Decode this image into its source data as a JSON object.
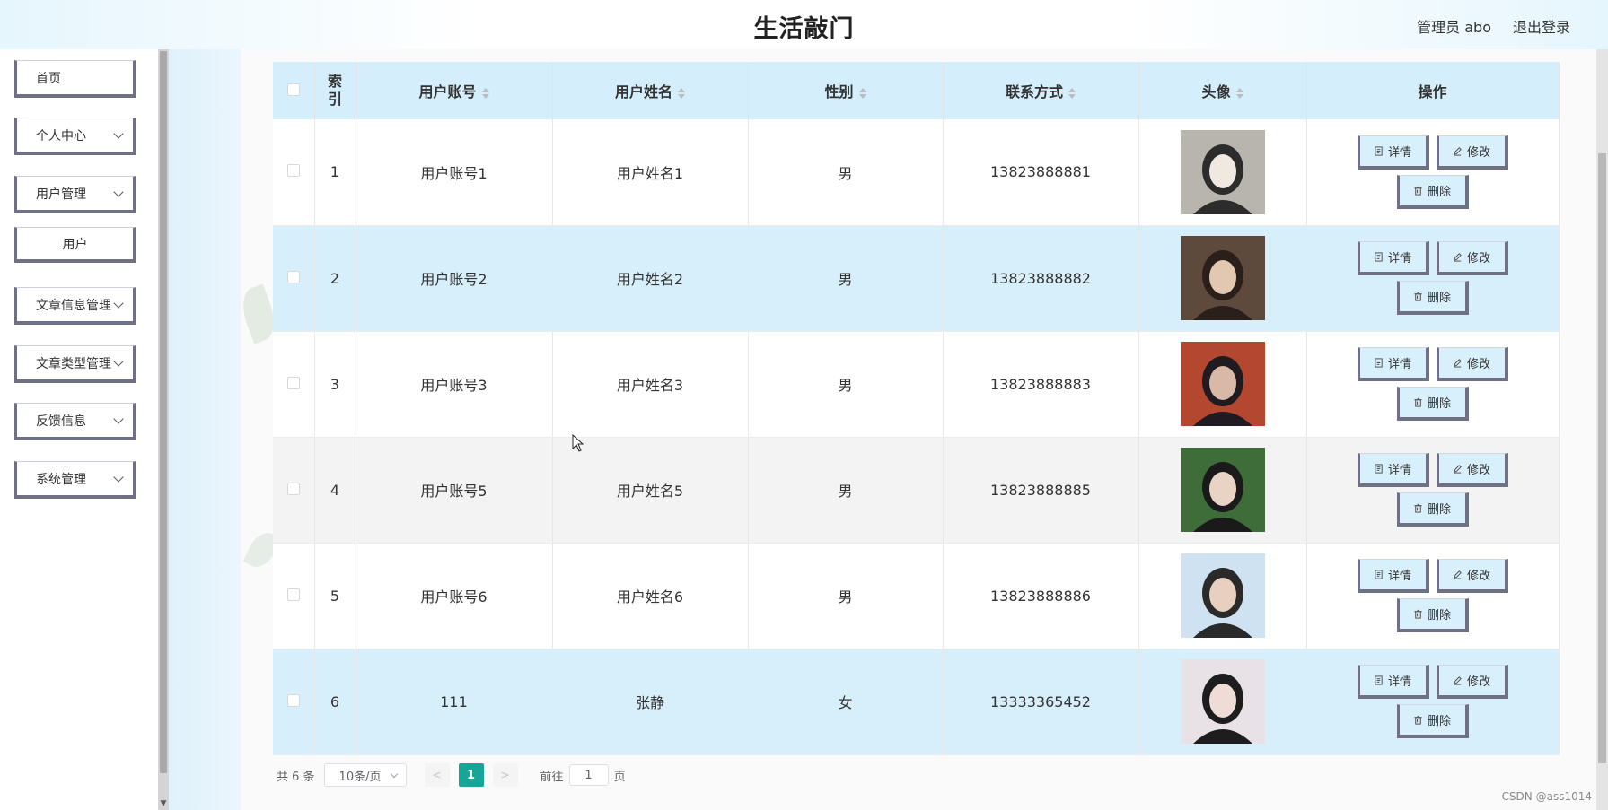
{
  "header": {
    "title": "生活敲门",
    "user_label": "管理员 abo",
    "logout_label": "退出登录"
  },
  "sidebar": {
    "items": [
      {
        "label": "首页"
      },
      {
        "label": "个人中心"
      },
      {
        "label": "用户管理"
      },
      {
        "label": "用户"
      },
      {
        "label": "文章信息管理"
      },
      {
        "label": "文章类型管理"
      },
      {
        "label": "反馈信息"
      },
      {
        "label": "系统管理"
      }
    ]
  },
  "table": {
    "columns": [
      "索引",
      "用户账号",
      "用户姓名",
      "性别",
      "联系方式",
      "头像",
      "操作"
    ],
    "rows": [
      {
        "index": "1",
        "account": "用户账号1",
        "name": "用户姓名1",
        "gender": "男",
        "phone": "13823888881"
      },
      {
        "index": "2",
        "account": "用户账号2",
        "name": "用户姓名2",
        "gender": "男",
        "phone": "13823888882"
      },
      {
        "index": "3",
        "account": "用户账号3",
        "name": "用户姓名3",
        "gender": "男",
        "phone": "13823888883"
      },
      {
        "index": "4",
        "account": "用户账号5",
        "name": "用户姓名5",
        "gender": "男",
        "phone": "13823888885"
      },
      {
        "index": "5",
        "account": "用户账号6",
        "name": "用户姓名6",
        "gender": "男",
        "phone": "13823888886"
      },
      {
        "index": "6",
        "account": "111",
        "name": "张静",
        "gender": "女",
        "phone": "13333365452"
      }
    ],
    "actions": {
      "detail": "详情",
      "edit": "修改",
      "delete": "删除"
    }
  },
  "pagination": {
    "total_text": "共 6 条",
    "page_size": "10条/页",
    "current_page": "1",
    "goto_prefix": "前往",
    "goto_value": "1",
    "goto_suffix": "页"
  },
  "watermark": "CSDN @ass1014",
  "colors": {
    "accent": "#16a596",
    "header_row": "#d4eefb",
    "button_border": "#707085"
  }
}
